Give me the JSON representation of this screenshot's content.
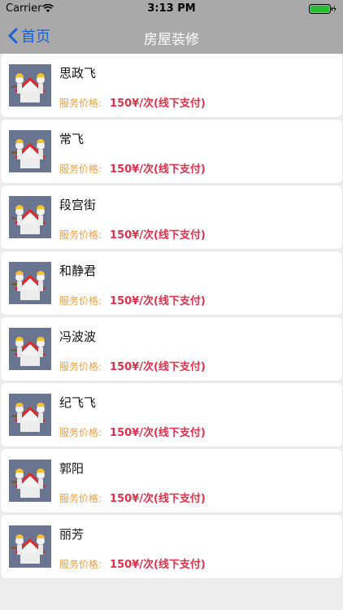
{
  "status": {
    "carrier": "Carrier",
    "time": "3:13 PM"
  },
  "nav": {
    "back_label": "首页",
    "title": "房屋装修"
  },
  "colors": {
    "bar": "#a9a9a9",
    "back": "#1a5fd6",
    "price_label": "#f0a040",
    "price_value": "#e0314a"
  },
  "list": {
    "items": [
      {
        "name": "思政飞",
        "price_label": "服务价格:",
        "price": "150¥/次(线下支付)"
      },
      {
        "name": "常飞",
        "price_label": "服务价格:",
        "price": "150¥/次(线下支付)"
      },
      {
        "name": "段宫街",
        "price_label": "服务价格:",
        "price": "150¥/次(线下支付)"
      },
      {
        "name": "和静君",
        "price_label": "服务价格:",
        "price": "150¥/次(线下支付)"
      },
      {
        "name": "冯波波",
        "price_label": "服务价格:",
        "price": "150¥/次(线下支付)"
      },
      {
        "name": "纪飞飞",
        "price_label": "服务价格:",
        "price": "150¥/次(线下支付)"
      },
      {
        "name": "郭阳",
        "price_label": "服务价格:",
        "price": "150¥/次(线下支付)"
      },
      {
        "name": "丽芳",
        "price_label": "服务价格:",
        "price": "150¥/次(线下支付)"
      }
    ]
  }
}
